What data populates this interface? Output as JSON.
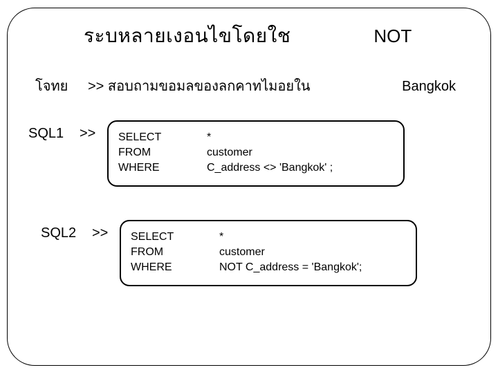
{
  "title": {
    "th": "ระบหลายเงอนไขโดยใช",
    "not": "NOT"
  },
  "question": {
    "label": "โจทย",
    "arrows": ">>",
    "text": "สอบถามขอมลของลกคาทไมอยใน",
    "city": "Bangkok"
  },
  "sql1": {
    "label": "SQL1",
    "arrow": ">>",
    "select_kw": "SELECT",
    "select_val": "*",
    "from_kw": "FROM",
    "from_val": "customer",
    "where_kw": "WHERE",
    "where_val": "C_address  <> 'Bangkok' ;"
  },
  "sql2": {
    "label": "SQL2",
    "arrow": ">>",
    "select_kw": "SELECT",
    "select_val": "*",
    "from_kw": "FROM",
    "from_val": "customer",
    "where_kw": "WHERE",
    "where_val": "NOT  C_address = 'Bangkok';"
  }
}
